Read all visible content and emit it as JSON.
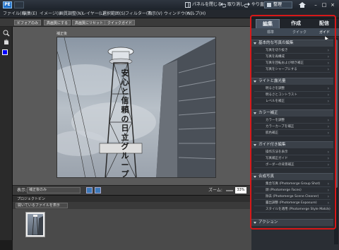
{
  "titlebar": {
    "logo": "PE",
    "actions": [
      {
        "label": "パネルを閉じる"
      },
      {
        "label": "取り消し"
      },
      {
        "label": "やり直し"
      },
      {
        "label": "表示"
      }
    ],
    "sort_label": "整理",
    "icons": [
      "home-icon",
      "minimize-icon",
      "maximize-icon",
      "close-icon"
    ]
  },
  "menubar": {
    "items": [
      "ファイル(F)",
      "編集(E)",
      "イメージ(I)",
      "画質調整(N)",
      "レイヤー(L)",
      "選択範囲(S)",
      "フィルター(T)",
      "表示(V)",
      "ウィンドウ(W)",
      "ヘルプ(H)"
    ]
  },
  "options": {
    "buttons": [
      "ビフォアのみ",
      "高画質にする",
      "高画質にリセット",
      "クイックガイド"
    ]
  },
  "canvas": {
    "doc_label": "補正後",
    "photo_sign_text": "安心と信頼の日立グループ"
  },
  "status": {
    "view_label": "表示:",
    "view_value": "補正後のみ",
    "zoom_label": "ズーム:",
    "zoom_value": "33%"
  },
  "bin": {
    "title": "プロジェクトビン",
    "dropdown": "開いているファイルを表示"
  },
  "panel": {
    "tabs": [
      {
        "label": "編集",
        "active": true
      },
      {
        "label": "作成",
        "active": false
      },
      {
        "label": "配信",
        "active": false
      }
    ],
    "subtabs": [
      {
        "label": "標準",
        "active": false
      },
      {
        "label": "クイック",
        "active": false
      },
      {
        "label": "ガイド",
        "active": true
      }
    ],
    "sections": [
      {
        "title": "基本的な写真の編集",
        "items": [
          "写真を切り抜き",
          "写真を再構成",
          "写真を回転および傾き補正",
          "写真をシャープにする"
        ]
      },
      {
        "title": "ライトと露光量",
        "items": [
          "明るさを調整",
          "明るさとコントラスト",
          "レベルを補正"
        ]
      },
      {
        "title": "カラー補正",
        "items": [
          "カラーを調整",
          "カラーカーブを補正",
          "肌色補正"
        ]
      },
      {
        "title": "ガイド付き編集",
        "items": [
          "操作方法を表示",
          "写真補正ガイド",
          "ボーダーの背景補正"
        ]
      },
      {
        "title": "合成写真",
        "items": [
          "集合写真 (Photomerge Group Shot)",
          "顔 (Photomerge Faces)",
          "除去 (Photomerge Scene Cleaner)",
          "露出調整 (Photomerge Exposure)",
          "スタイルを適用 (Photomerge Style Match)"
        ]
      },
      {
        "title": "アクション",
        "items": []
      }
    ]
  },
  "colors": {
    "highlight_border": "#d81818",
    "foreground_swatch": "#0000ff",
    "background_swatch": "#ffffff"
  }
}
